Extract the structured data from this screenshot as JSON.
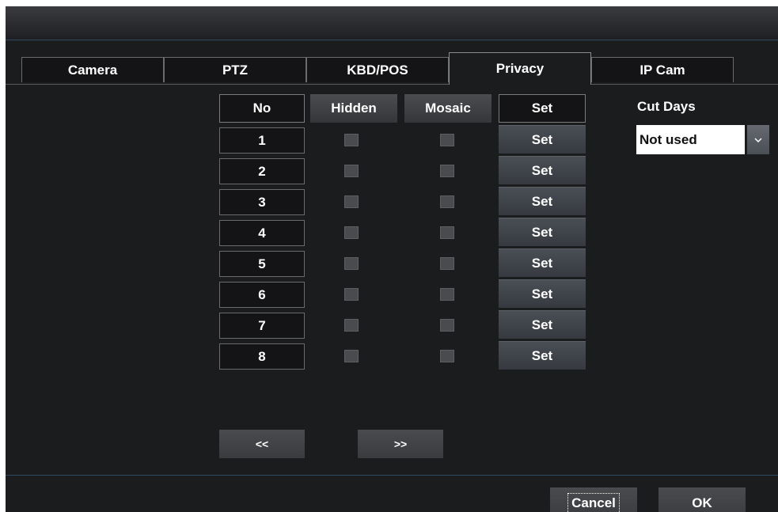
{
  "tabs": [
    {
      "label": "Camera",
      "active": false
    },
    {
      "label": "PTZ",
      "active": false
    },
    {
      "label": "KBD/POS",
      "active": false
    },
    {
      "label": "Privacy",
      "active": true
    },
    {
      "label": "IP Cam",
      "active": false
    }
  ],
  "table": {
    "headers": {
      "no": "No",
      "hidden": "Hidden",
      "mosaic": "Mosaic",
      "set": "Set"
    },
    "rows": [
      {
        "no": "1",
        "hidden": false,
        "mosaic": false,
        "set_label": "Set"
      },
      {
        "no": "2",
        "hidden": false,
        "mosaic": false,
        "set_label": "Set"
      },
      {
        "no": "3",
        "hidden": false,
        "mosaic": false,
        "set_label": "Set"
      },
      {
        "no": "4",
        "hidden": false,
        "mosaic": false,
        "set_label": "Set"
      },
      {
        "no": "5",
        "hidden": false,
        "mosaic": false,
        "set_label": "Set"
      },
      {
        "no": "6",
        "hidden": false,
        "mosaic": false,
        "set_label": "Set"
      },
      {
        "no": "7",
        "hidden": false,
        "mosaic": false,
        "set_label": "Set"
      },
      {
        "no": "8",
        "hidden": false,
        "mosaic": false,
        "set_label": "Set"
      }
    ]
  },
  "cut_days": {
    "label": "Cut Days",
    "value": "Not used",
    "arrow_icon": "chevron-down-icon"
  },
  "pagination": {
    "prev_label": "<<",
    "next_label": ">>"
  },
  "footer": {
    "cancel_label": "Cancel",
    "ok_label": "OK"
  },
  "colors": {
    "background": "#1b1c1e",
    "accent_line": "#31495e",
    "button": "#3a3e44"
  }
}
